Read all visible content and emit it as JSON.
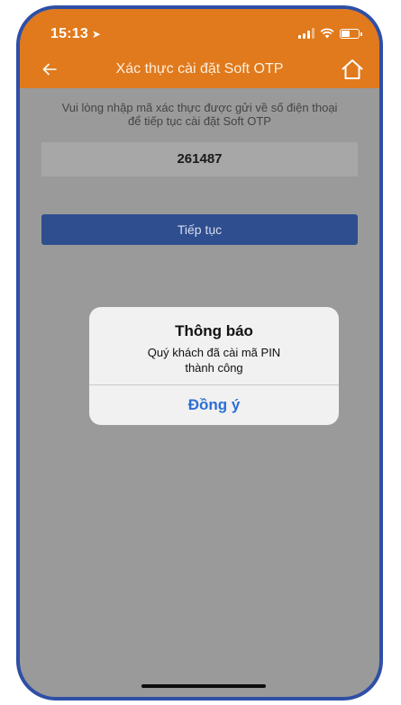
{
  "status_bar": {
    "time": "15:13",
    "location_icon": "location-arrow-icon",
    "icons": [
      "signal-icon",
      "wifi-icon",
      "battery-icon"
    ]
  },
  "nav": {
    "title": "Xác thực cài đặt Soft OTP",
    "back_icon": "back-arrow-icon",
    "home_icon": "home-icon"
  },
  "main": {
    "instructions": "Vui lòng nhập mã xác thực được gửi về số điện thoại để tiếp tục cài đặt Soft OTP",
    "otp_value": "261487",
    "continue_label": "Tiếp tục"
  },
  "dialog": {
    "title": "Thông báo",
    "message_line1": "Quý khách đã cài mã PIN",
    "message_line2": "thành công",
    "action_label": "Đồng ý"
  },
  "colors": {
    "header": "#e07a1d",
    "overlay": "#9a9a9a",
    "primary_button": "#2f4e8f",
    "dialog_action": "#2a6fd6",
    "frame": "#2f4fa6"
  }
}
